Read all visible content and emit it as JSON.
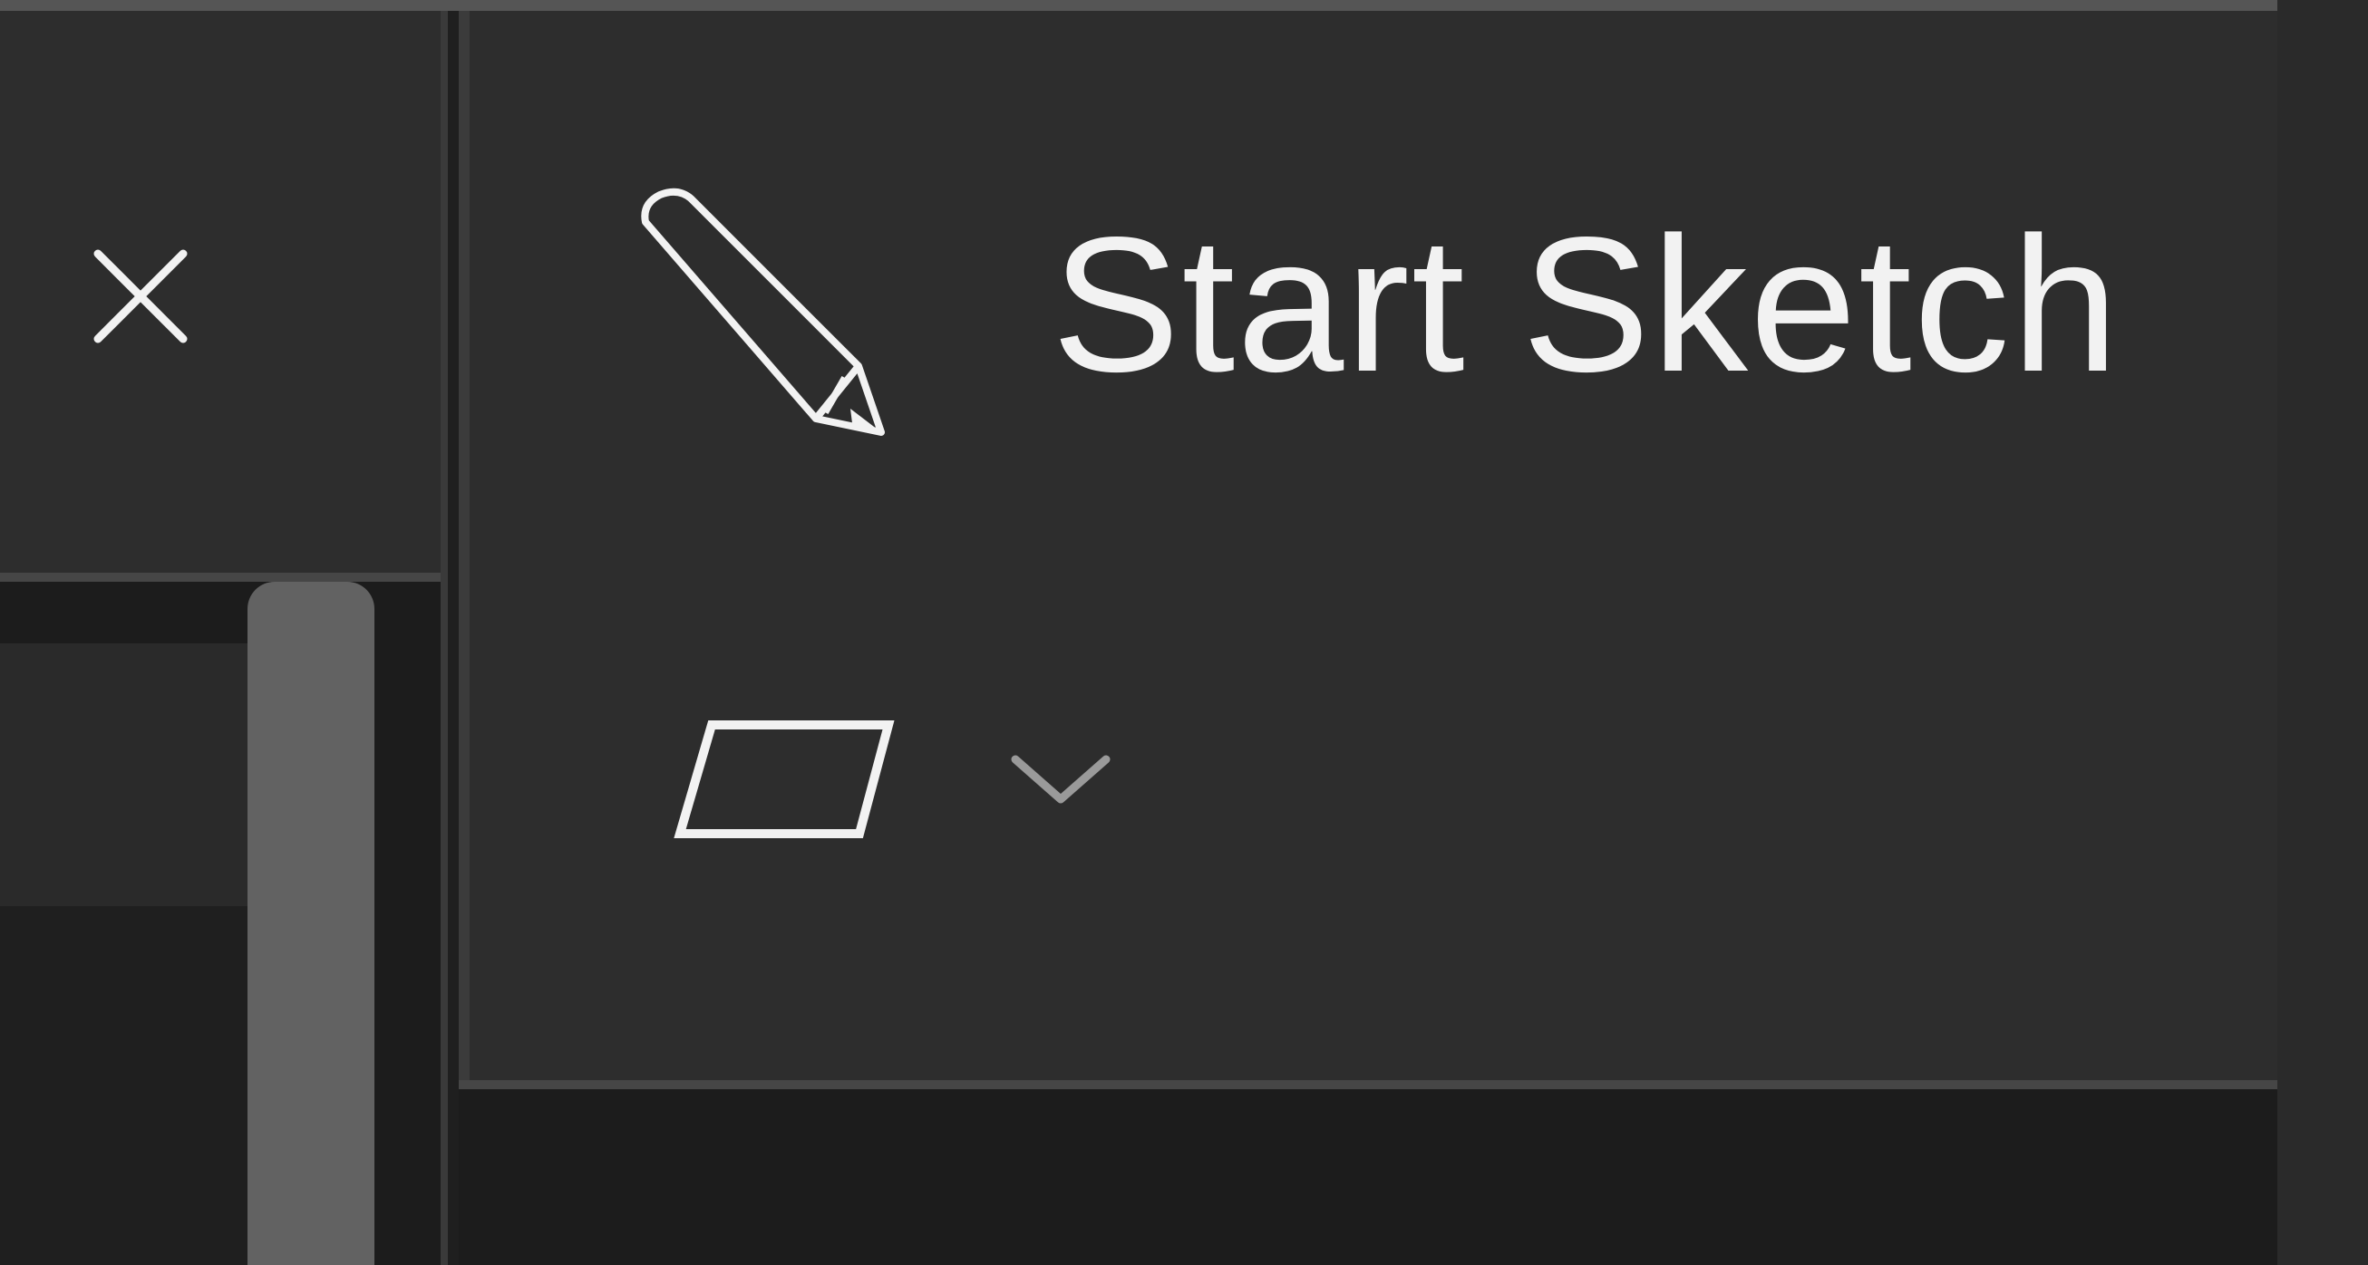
{
  "toolbar": {
    "start_sketch_label": "Start Sketch"
  },
  "icons": {
    "close": "close-icon",
    "pencil": "pencil-icon",
    "plane_shape": "parallelogram-icon",
    "dropdown": "chevron-down-icon"
  },
  "colors": {
    "panel_background": "#2d2d2d",
    "app_background": "#1c1c1c",
    "text": "#f2f2f2",
    "scroll_thumb": "#626262"
  }
}
